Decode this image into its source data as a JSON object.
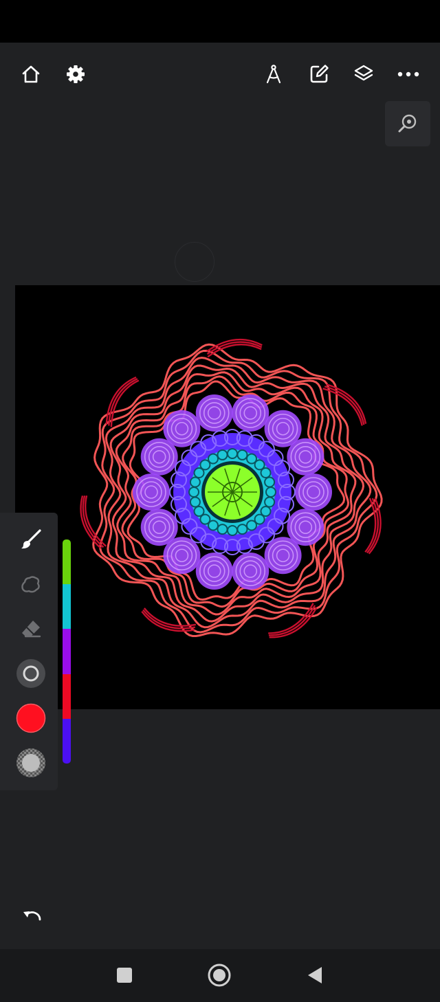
{
  "toolbar": {
    "left": [
      "home-icon",
      "gear-icon"
    ],
    "right": [
      "compass-icon",
      "edit-icon",
      "layers-icon",
      "more-icon"
    ]
  },
  "canvas": {
    "background": "#000000",
    "artwork": "mandala",
    "colors": {
      "outer": "#ff5a5a",
      "tips": "#c8102e",
      "petals": "#a24bff",
      "ring": "#5a2dff",
      "inner": "#1ec8d8",
      "center": "#8cff2a"
    }
  },
  "tools": {
    "brush": "brush-icon",
    "smudge": "smudge-icon",
    "eraser": "eraser-icon",
    "size": "brush-size-icon",
    "current_color": "#ff1020",
    "opacity": "opacity-icon"
  },
  "palette": [
    "#6ad40c",
    "#13c6d4",
    "#9a0eea",
    "#ee0a24",
    "#4b10f2"
  ],
  "nav": [
    "recent-apps-icon",
    "home-nav-icon",
    "back-icon"
  ]
}
